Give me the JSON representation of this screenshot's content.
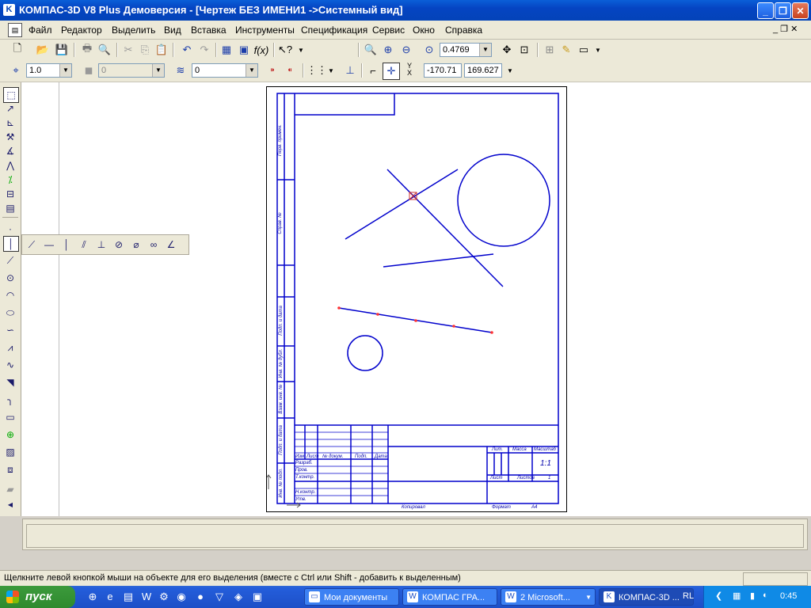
{
  "window": {
    "title": "КОМПАС-3D V8 Plus Демоверсия - [Чертеж БЕЗ ИМЕНИ1 ->Системный вид]",
    "btn_minimize": "_",
    "btn_maximize": "❐",
    "btn_close": "✕"
  },
  "menu": {
    "items": [
      "Файл",
      "Редактор",
      "Выделить",
      "Вид",
      "Вставка",
      "Инструменты",
      "Спецификация",
      "Сервис",
      "Окно",
      "Справка"
    ],
    "doc_controls": "_ ❐ ✕"
  },
  "toolbar1": {
    "zoom_value": "0.4769"
  },
  "toolbar2": {
    "step_value": "1.0",
    "layer_disabled_value": "0",
    "layer_value": "0",
    "coord_label": "Y\nX",
    "coord_x": "-170.71",
    "coord_y": "169.627"
  },
  "status": {
    "hint": "Щелкните левой кнопкой мыши на объекте для его выделения (вместе с Ctrl или Shift - добавить к выделенным)"
  },
  "taskbar": {
    "start_label": "пуск",
    "tasks": [
      "Мои документы",
      "КОМПАС ГРА...",
      "2 Microsoft...",
      "КОМПАС-3D ..."
    ],
    "tray_lang": "RL",
    "clock": "0:45"
  },
  "sheet": {
    "side_labels": [
      "Перв. примен.",
      "Справ. №",
      "Подп. и дата",
      "Инв. № дубл.",
      "Взам. инв. №",
      "Подп. и дата",
      "Инв. № подл."
    ],
    "stamp": {
      "izm": "Изм.",
      "list": "Лист",
      "ndokum": "№ докум.",
      "podp": "Подп.",
      "data": "Дата",
      "razrab": "Разраб.",
      "prov": "Пров.",
      "tkontr": "Т.контр.",
      "nkontr": "Н.контр.",
      "utv": "Утв.",
      "lit": "Лит.",
      "massa": "Масса",
      "masshtab": "Масштаб",
      "scale_value": "1:1",
      "list2": "Лист",
      "listov": "Листов",
      "listov_value": "1",
      "kopiroval": "Копировал",
      "format": "Формат",
      "format_value": "A4"
    }
  }
}
